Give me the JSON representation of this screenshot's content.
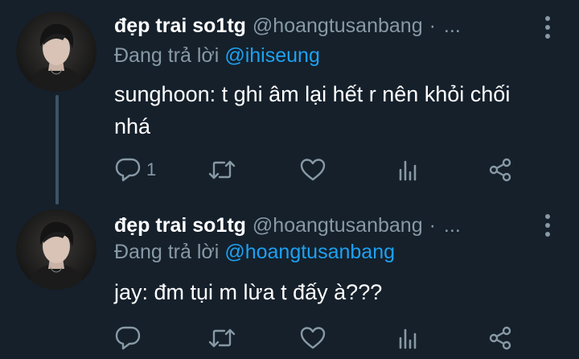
{
  "tweets": [
    {
      "display_name": "đẹp trai so1tg",
      "handle": "@hoangtusanbang",
      "separator": "·",
      "overflow": "...",
      "reply_prefix": "Đang trả lời",
      "reply_to": "@ihiseung",
      "text": "sunghoon: t ghi âm lại hết r nên khỏi chối nhá",
      "reply_count": "1",
      "icons": [
        "reply-icon",
        "retweet-icon",
        "like-icon",
        "stats-icon",
        "share-icon",
        "more-icon"
      ]
    },
    {
      "display_name": "đẹp trai so1tg",
      "handle": "@hoangtusanbang",
      "separator": "·",
      "overflow": "...",
      "reply_prefix": "Đang trả lời",
      "reply_to": "@hoangtusanbang",
      "text": "jay: đm tụi m lừa t đấy à???",
      "reply_count": "",
      "icons": [
        "reply-icon",
        "retweet-icon",
        "like-icon",
        "stats-icon",
        "share-icon",
        "more-icon"
      ]
    }
  ],
  "colors": {
    "background": "#15202b",
    "secondary_text": "#8899a6",
    "link": "#1da1f2",
    "thread_line": "#3d5466"
  }
}
